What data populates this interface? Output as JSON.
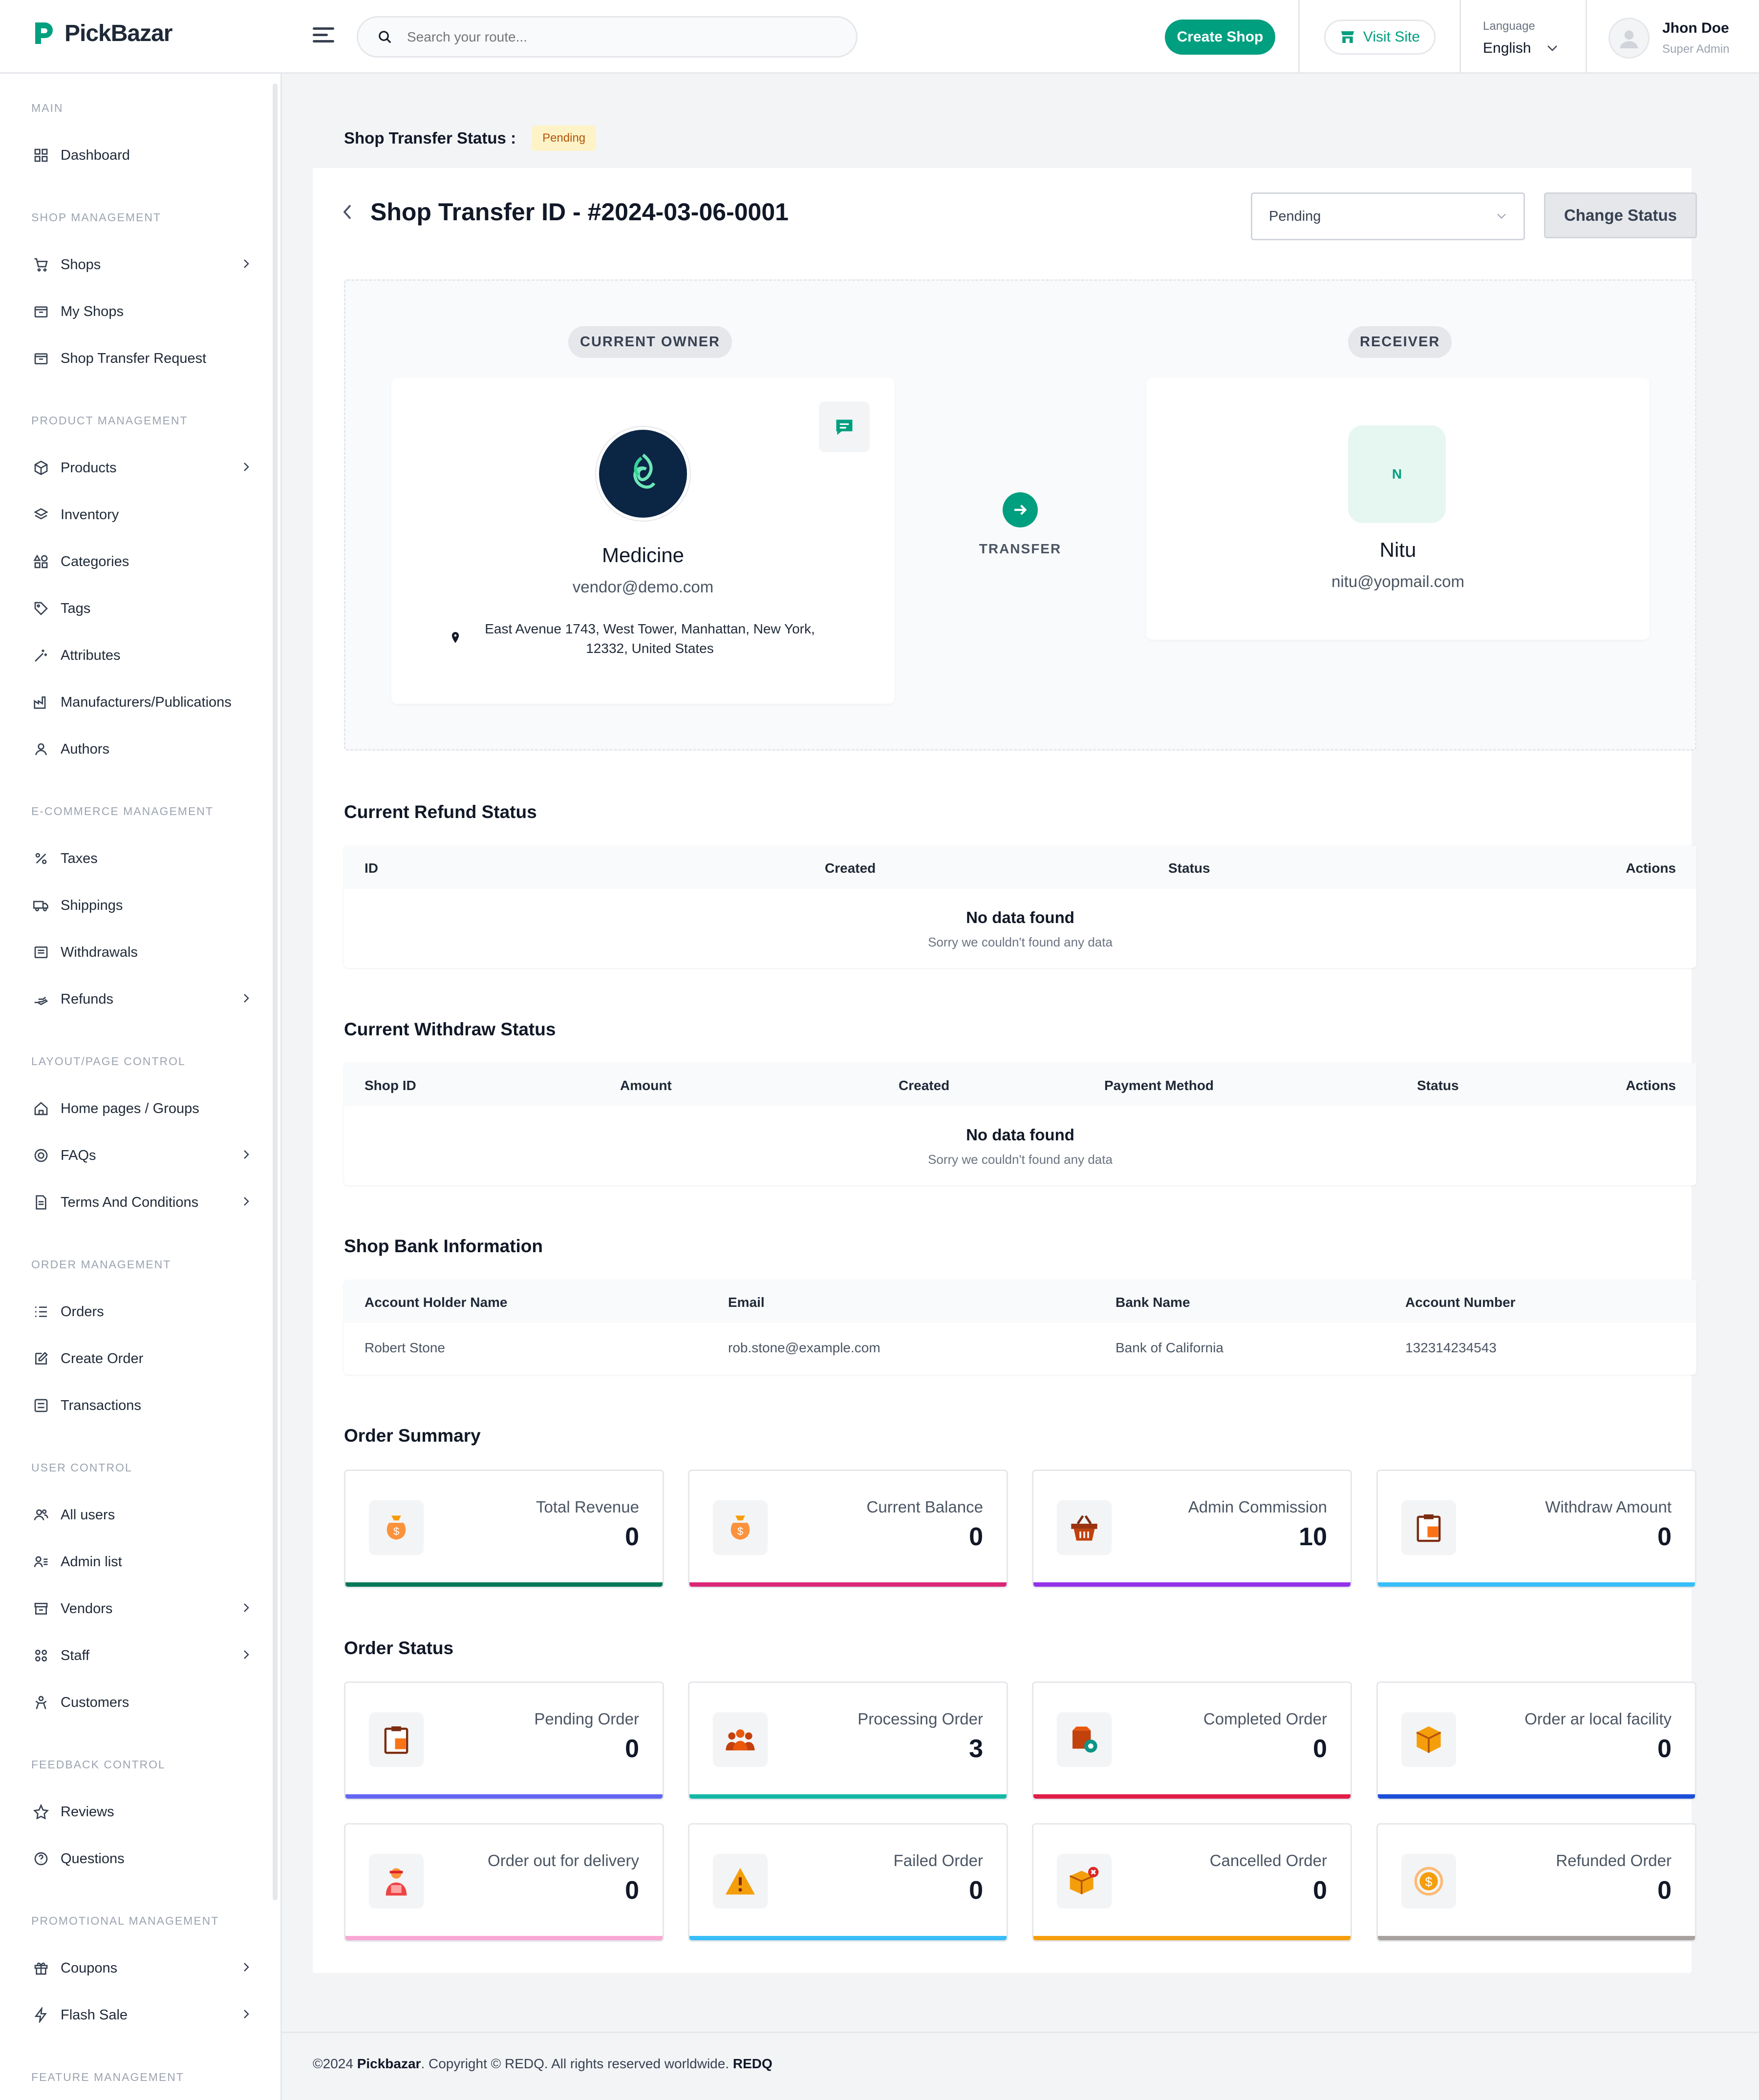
{
  "brand": {
    "name": "PickBazar"
  },
  "header": {
    "search_placeholder": "Search your route...",
    "create_shop": "Create Shop",
    "visit_site": "Visit Site",
    "language_label": "Language",
    "language_value": "English",
    "user_name": "Jhon Doe",
    "user_role": "Super Admin"
  },
  "sidebar": {
    "sections": {
      "main": "MAIN",
      "shop": "SHOP MANAGEMENT",
      "product": "PRODUCT MANAGEMENT",
      "ecom": "E-COMMERCE MANAGEMENT",
      "layout": "LAYOUT/PAGE CONTROL",
      "order": "ORDER MANAGEMENT",
      "user": "USER CONTROL",
      "feedback": "FEEDBACK CONTROL",
      "promo": "PROMOTIONAL MANAGEMENT",
      "feature": "FEATURE MANAGEMENT"
    },
    "items": {
      "dashboard": "Dashboard",
      "shops": "Shops",
      "my_shops": "My Shops",
      "shop_transfer": "Shop Transfer Request",
      "products": "Products",
      "inventory": "Inventory",
      "categories": "Categories",
      "tags": "Tags",
      "attributes": "Attributes",
      "manufacturers": "Manufacturers/Publications",
      "authors": "Authors",
      "taxes": "Taxes",
      "shippings": "Shippings",
      "withdrawals": "Withdrawals",
      "refunds": "Refunds",
      "home_pages": "Home pages / Groups",
      "faqs": "FAQs",
      "terms": "Terms And Conditions",
      "orders": "Orders",
      "create_order": "Create Order",
      "transactions": "Transactions",
      "all_users": "All users",
      "admin_list": "Admin list",
      "vendors": "Vendors",
      "staff": "Staff",
      "customers": "Customers",
      "reviews": "Reviews",
      "questions": "Questions",
      "coupons": "Coupons",
      "flash_sale": "Flash Sale"
    }
  },
  "status_bar": {
    "label": "Shop Transfer Status :",
    "badge": "Pending"
  },
  "page": {
    "title": "Shop Transfer ID - #2024-03-06-0001",
    "select_value": "Pending",
    "change_status": "Change Status"
  },
  "transfer": {
    "owner_label": "CURRENT OWNER",
    "receiver_label": "RECEIVER",
    "transfer_label": "TRANSFER",
    "owner": {
      "name": "Medicine",
      "email": "vendor@demo.com",
      "address_line1": "East Avenue 1743, West Tower, Manhattan, New York,",
      "address_line2": "12332, United States"
    },
    "receiver": {
      "initial": "N",
      "name": "Nitu",
      "email": "nitu@yopmail.com"
    }
  },
  "refund": {
    "title": "Current Refund Status",
    "cols": [
      "ID",
      "Created",
      "Status",
      "Actions"
    ],
    "empty_title": "No data found",
    "empty_sub": "Sorry we couldn't found any data"
  },
  "withdraw": {
    "title": "Current Withdraw Status",
    "cols": [
      "Shop ID",
      "Amount",
      "Created",
      "Payment Method",
      "Status",
      "Actions"
    ],
    "empty_title": "No data found",
    "empty_sub": "Sorry we couldn't found any data"
  },
  "bank": {
    "title": "Shop Bank Information",
    "cols": [
      "Account Holder Name",
      "Email",
      "Bank Name",
      "Account Number"
    ],
    "row": [
      "Robert Stone",
      "rob.stone@example.com",
      "Bank of California",
      "132314234543"
    ]
  },
  "order_summary": {
    "title": "Order Summary",
    "cards": [
      {
        "label": "Total Revenue",
        "value": "0",
        "color": "#047857"
      },
      {
        "label": "Current Balance",
        "value": "0",
        "color": "#db2777"
      },
      {
        "label": "Admin Commission",
        "value": "10",
        "color": "#9333ea"
      },
      {
        "label": "Withdraw Amount",
        "value": "0",
        "color": "#38bdf8"
      }
    ]
  },
  "order_status": {
    "title": "Order Status",
    "cards": [
      {
        "label": "Pending Order",
        "value": "0",
        "color": "#6366f1"
      },
      {
        "label": "Processing Order",
        "value": "3",
        "color": "#14b8a6"
      },
      {
        "label": "Completed Order",
        "value": "0",
        "color": "#e11d48"
      },
      {
        "label": "Order ar local facility",
        "value": "0",
        "color": "#1d4ed8"
      },
      {
        "label": "Order out for delivery",
        "value": "0",
        "color": "#f9a8d4"
      },
      {
        "label": "Failed Order",
        "value": "0",
        "color": "#38bdf8"
      },
      {
        "label": "Cancelled Order",
        "value": "0",
        "color": "#f59e0b"
      },
      {
        "label": "Refunded Order",
        "value": "0",
        "color": "#a8a29e"
      }
    ]
  },
  "footer": {
    "year": "©2024",
    "brand": "Pickbazar",
    "rest": ". Copyright © REDQ. All rights reserved worldwide.",
    "company": "REDQ"
  }
}
